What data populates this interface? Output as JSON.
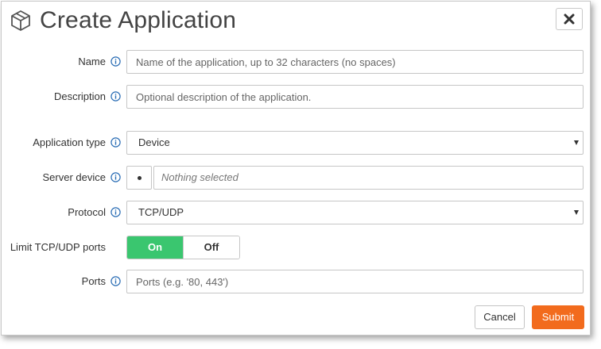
{
  "dialog": {
    "title": "Create Application",
    "close_label": "✕"
  },
  "form": {
    "name": {
      "label": "Name",
      "placeholder": "Name of the application, up to 32 characters (no spaces)"
    },
    "description": {
      "label": "Description",
      "placeholder": "Optional description of the application."
    },
    "application_type": {
      "label": "Application type",
      "value": "Device"
    },
    "server_device": {
      "label": "Server device",
      "value": "Nothing selected"
    },
    "protocol": {
      "label": "Protocol",
      "value": "TCP/UDP"
    },
    "limit_ports": {
      "label": "Limit TCP/UDP ports",
      "on_label": "On",
      "off_label": "Off",
      "selected": "On"
    },
    "ports": {
      "label": "Ports",
      "placeholder": "Ports (e.g. '80, 443')"
    }
  },
  "buttons": {
    "cancel": "Cancel",
    "submit": "Submit"
  },
  "colors": {
    "accent_info": "#2a6db5",
    "toggle_on": "#3ac66f",
    "submit": "#f26b1d"
  }
}
